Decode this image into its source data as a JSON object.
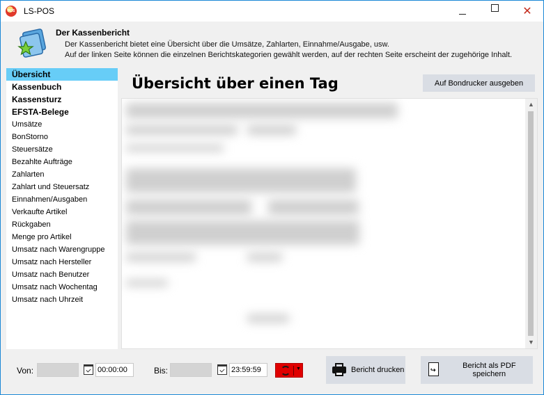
{
  "window": {
    "title": "LS-POS",
    "icon_text": "POS",
    "minimize_glyph": "—",
    "maximize_glyph": "☐",
    "close_glyph": "✕"
  },
  "header": {
    "title": "Der Kassenbericht",
    "desc_line1": "Der Kassenbericht bietet eine Übersicht über die Umsätze, Zahlarten, Einnahme/Ausgabe, usw.",
    "desc_line2": "Auf der linken Seite können die einzelnen Berichtskategorien gewählt werden, auf der rechten Seite erscheint der zugehörige Inhalt."
  },
  "sidebar": {
    "selected": "Übersicht",
    "items": [
      {
        "label": "Übersicht",
        "bold": true
      },
      {
        "label": "Kassenbuch",
        "bold": true
      },
      {
        "label": "Kassensturz",
        "bold": true
      },
      {
        "label": "EFSTA-Belege",
        "bold": true
      },
      {
        "label": "Umsätze",
        "bold": false
      },
      {
        "label": "BonStorno",
        "bold": false
      },
      {
        "label": "Steuersätze",
        "bold": false
      },
      {
        "label": "Bezahlte Aufträge",
        "bold": false
      },
      {
        "label": "Zahlarten",
        "bold": false
      },
      {
        "label": "Zahlart und Steuersatz",
        "bold": false
      },
      {
        "label": "Einnahmen/Ausgaben",
        "bold": false
      },
      {
        "label": "Verkaufte Artikel",
        "bold": false
      },
      {
        "label": "Rückgaben",
        "bold": false
      },
      {
        "label": "Menge pro Artikel",
        "bold": false
      },
      {
        "label": "Umsatz nach Warengruppe",
        "bold": false
      },
      {
        "label": "Umsatz nach Hersteller",
        "bold": false
      },
      {
        "label": "Umsatz nach Benutzer",
        "bold": false
      },
      {
        "label": "Umsatz nach Wochentag",
        "bold": false
      },
      {
        "label": "Umsatz nach Uhrzeit",
        "bold": false
      }
    ]
  },
  "main": {
    "title": "Übersicht über einen Tag",
    "bondrucker_label": "Auf Bondrucker ausgeben"
  },
  "bottom": {
    "von_label": "Von:",
    "von_time": "00:00:00",
    "bis_label": "Bis:",
    "bis_time": "23:59:59",
    "print_label": "Bericht drucken",
    "pdf_label": "Bericht als PDF speichern"
  },
  "colors": {
    "selected_bg": "#67cdf7",
    "refresh_button": "#e00000",
    "window_border": "#1b88d6"
  }
}
